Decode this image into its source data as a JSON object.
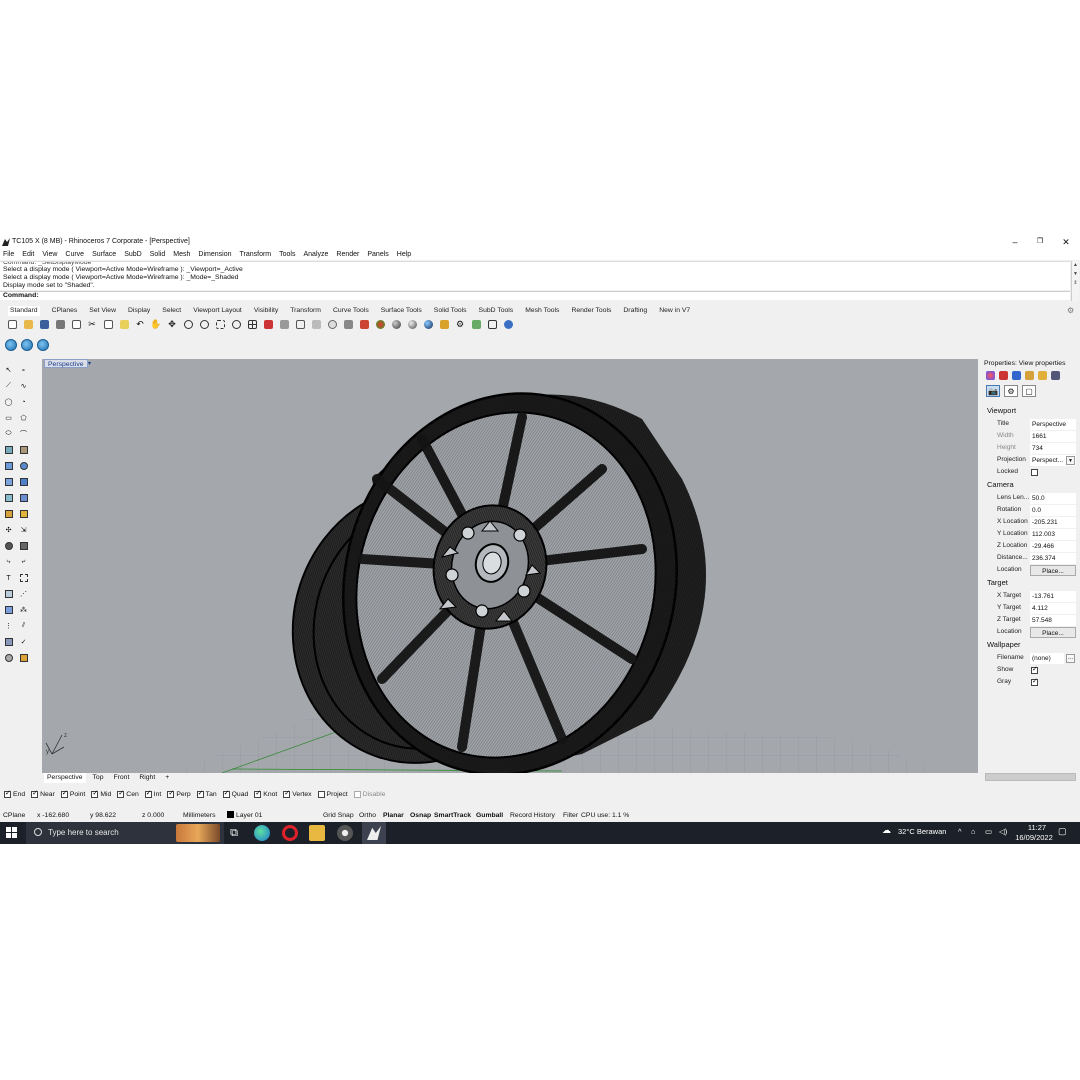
{
  "window": {
    "title": "TC105 X (8 MB) - Rhinoceros 7 Corporate - [Perspective]"
  },
  "menu": [
    "File",
    "Edit",
    "View",
    "Curve",
    "Surface",
    "SubD",
    "Solid",
    "Mesh",
    "Dimension",
    "Transform",
    "Tools",
    "Analyze",
    "Render",
    "Panels",
    "Help"
  ],
  "command": {
    "history": [
      "Command: _SetDisplayMode",
      "Select a display mode ( Viewport=Active  Mode=Wireframe ): _Viewport=_Active",
      "Select a display mode ( Viewport=Active  Mode=Wireframe ): _Mode=_Shaded",
      "Display mode set to \"Shaded\"."
    ],
    "prompt": "Command:"
  },
  "toolbar_tabs": [
    "Standard",
    "CPlanes",
    "Set View",
    "Display",
    "Select",
    "Viewport Layout",
    "Visibility",
    "Transform",
    "Curve Tools",
    "Surface Tools",
    "Solid Tools",
    "SubD Tools",
    "Mesh Tools",
    "Render Tools",
    "Drafting",
    "New in V7"
  ],
  "viewport": {
    "label": "Perspective",
    "tabs": [
      "Perspective",
      "Top",
      "Front",
      "Right"
    ],
    "add_tab": "+"
  },
  "osnaps": [
    {
      "label": "End",
      "checked": true
    },
    {
      "label": "Near",
      "checked": true
    },
    {
      "label": "Point",
      "checked": true
    },
    {
      "label": "Mid",
      "checked": true
    },
    {
      "label": "Cen",
      "checked": true
    },
    {
      "label": "Int",
      "checked": true
    },
    {
      "label": "Perp",
      "checked": true
    },
    {
      "label": "Tan",
      "checked": true
    },
    {
      "label": "Quad",
      "checked": true
    },
    {
      "label": "Knot",
      "checked": true
    },
    {
      "label": "Vertex",
      "checked": true
    },
    {
      "label": "Project",
      "checked": false
    },
    {
      "label": "Disable",
      "checked": false
    }
  ],
  "status": {
    "cplane": "CPlane",
    "x": "x -162.680",
    "y": "y 98.622",
    "z": "z 0.000",
    "units": "Millimeters",
    "layer": "Layer 01",
    "grid_snap": "Grid Snap",
    "ortho": "Ortho",
    "planar": "Planar",
    "osnap": "Osnap",
    "smarttrack": "SmartTrack",
    "gumball": "Gumball",
    "record_history": "Record History",
    "filter": "Filter",
    "cpu": "CPU use: 1.1 %"
  },
  "properties": {
    "header": "Properties: View properties",
    "viewport_section": "Viewport",
    "title_label": "Title",
    "title_value": "Perspective",
    "width_label": "Width",
    "width_value": "1661",
    "height_label": "Height",
    "height_value": "734",
    "projection_label": "Projection",
    "projection_value": "Perspect...",
    "locked_label": "Locked",
    "camera_section": "Camera",
    "lens_label": "Lens Len...",
    "lens_value": "50.0",
    "rotation_label": "Rotation",
    "rotation_value": "0.0",
    "xloc_label": "X Location",
    "xloc_value": "-205.231",
    "yloc_label": "Y Location",
    "yloc_value": "112.003",
    "zloc_label": "Z Location",
    "zloc_value": "-29.466",
    "dist_label": "Distance...",
    "dist_value": "236.374",
    "camloc_label": "Location",
    "place_button": "Place...",
    "target_section": "Target",
    "xt_label": "X Target",
    "xt_value": "-13.761",
    "yt_label": "Y Target",
    "yt_value": "4.112",
    "zt_label": "Z Target",
    "zt_value": "57.548",
    "tloc_label": "Location",
    "wallpaper_section": "Wallpaper",
    "filename_label": "Filename",
    "filename_value": "(none)",
    "dots": "...",
    "show_label": "Show",
    "gray_label": "Gray"
  },
  "taskbar": {
    "search_placeholder": "Type here to search",
    "weather": "32°C  Berawan",
    "time": "11:27",
    "date": "16/09/2022"
  },
  "colors": {
    "viewport_bg": "#a4a8ad",
    "taskbar_bg": "#1c2028",
    "accent": "#1a3b8a"
  }
}
